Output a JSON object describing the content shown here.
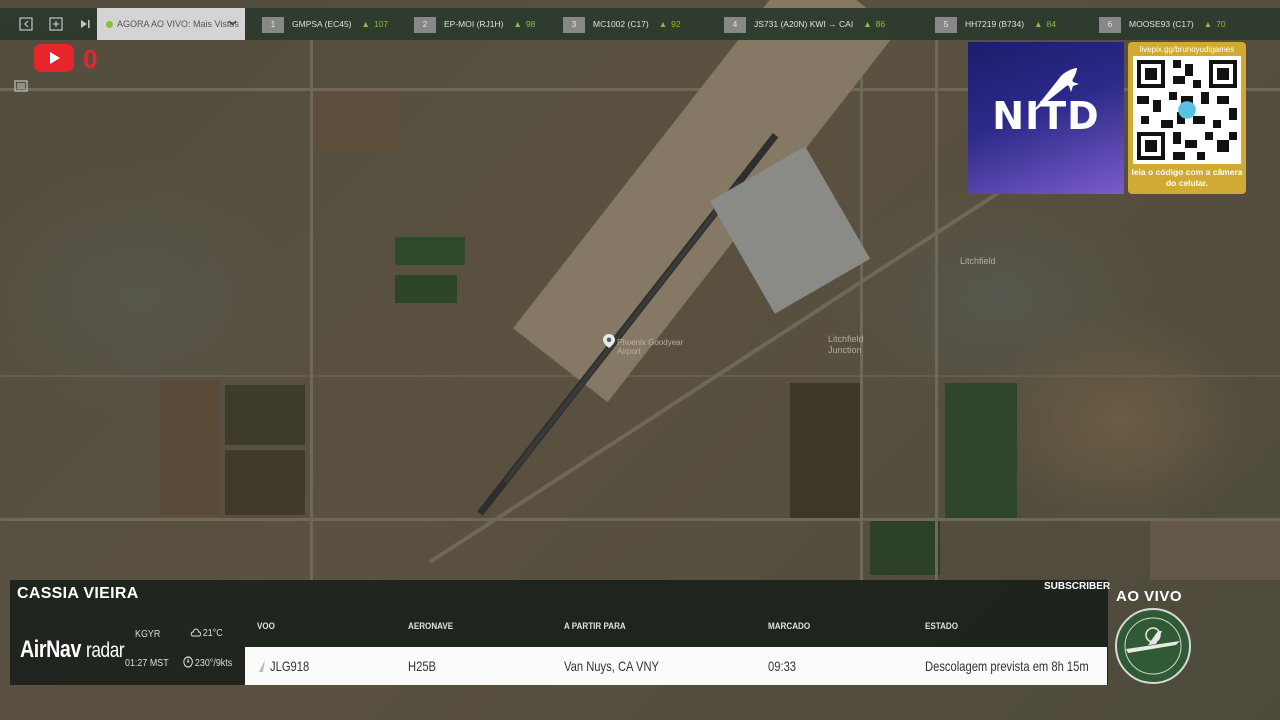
{
  "topbar": {
    "now_label": "AGORA AO VIVO: Mais Vistos",
    "flights": [
      {
        "rank": "1",
        "code": "GMPSA (EC45)",
        "count": "107"
      },
      {
        "rank": "2",
        "code": "EP-MOI (RJ1H)",
        "count": "98"
      },
      {
        "rank": "3",
        "code": "MC1002 (C17)",
        "count": "92"
      },
      {
        "rank": "4",
        "code": "JS731 (A20N)  KWI → CAI",
        "count": "86"
      },
      {
        "rank": "5",
        "code": "HH7219 (B734)",
        "count": "84"
      },
      {
        "rank": "6",
        "code": "MOOSE93 (C17)",
        "count": "70"
      }
    ]
  },
  "youtube": {
    "count": "0"
  },
  "promo": {
    "logo_text": "NITD",
    "qr_url": "livepix.gg/brunoyudigames",
    "qr_caption": "leia o código com a câmera do celular."
  },
  "map_labels": {
    "airport": "Phoenix Goodyear Airport",
    "litchfield": "Litchfield",
    "junction": "Litchfield Junction"
  },
  "panel": {
    "name": "CASSIA VIEIRA",
    "subscribe": "SUBSCRIBER",
    "brand_bold": "AirNav",
    "brand_light": "radar",
    "airport": "KGYR",
    "temperature": "21°C",
    "local_time": "01:27 MST",
    "wind": "230°/9kts",
    "headers": {
      "flight": "VOO",
      "aircraft": "AERONAVE",
      "route": "A PARTIR PARA",
      "scheduled": "MARCADO",
      "status": "ESTADO"
    },
    "row": {
      "flight": "JLG918",
      "aircraft": "H25B",
      "route": "Van Nuys, CA VNY",
      "scheduled": "09:33",
      "status": "Descolagem prevista em 8h 15m"
    },
    "live_label": "AO VIVO"
  },
  "colors": {
    "accent_green": "#8dc43d",
    "youtube_red": "#e6262a",
    "qr_gold": "#d0aa35"
  }
}
